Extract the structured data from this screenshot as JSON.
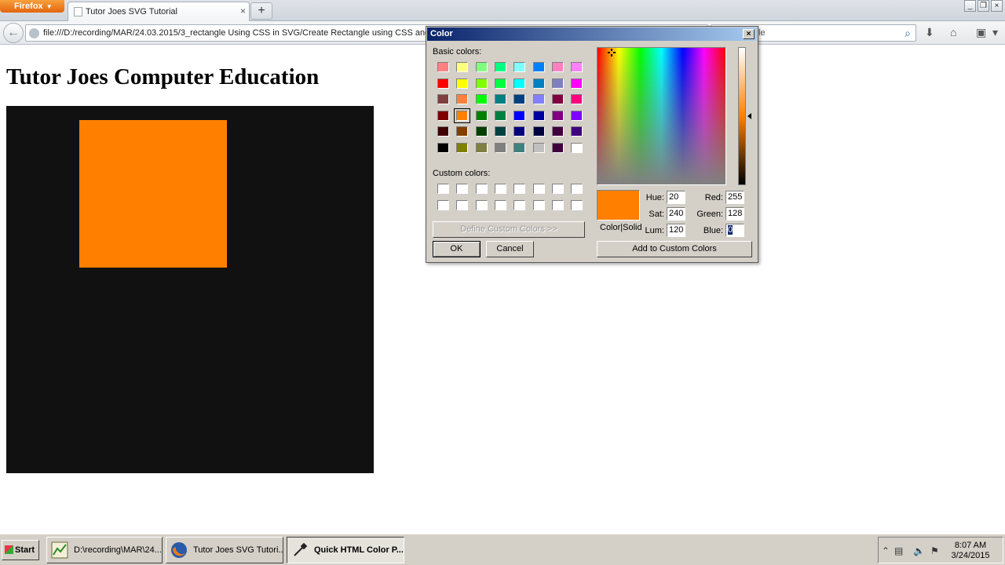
{
  "browser": {
    "menu_button": "Firefox",
    "tab_title": "Tutor Joes SVG Tutorial",
    "url": "file:///D:/recording/MAR/24.03.2015/3_rectangle Using CSS in SVG/Create Rectangle using CSS and SVG.html",
    "search_text": "le"
  },
  "page": {
    "heading": "Tutor Joes Computer Education",
    "svg_background": "#111111",
    "rect_fill": "#ff8000"
  },
  "color_dialog": {
    "title": "Color",
    "close_glyph": "×",
    "basic_colors_label": "Basic colors:",
    "custom_colors_label": "Custom colors:",
    "define_custom_button": "Define Custom Colors >>",
    "ok_button": "OK",
    "cancel_button": "Cancel",
    "add_custom_button": "Add to Custom Colors",
    "color_solid_label": "Color|Solid",
    "hue_label": "Hue:",
    "hue": "20",
    "sat_label": "Sat:",
    "sat": "240",
    "lum_label": "Lum:",
    "lum": "120",
    "red_label": "Red:",
    "red": "255",
    "green_label": "Green:",
    "green": "128",
    "blue_label": "Blue:",
    "blue": "0",
    "selected_color": "#ff8000",
    "basic_colors": [
      [
        "#ff8080",
        "#ffff80",
        "#80ff80",
        "#00ff80",
        "#80ffff",
        "#0080ff",
        "#ff80c0",
        "#ff80ff"
      ],
      [
        "#ff0000",
        "#ffff00",
        "#80ff00",
        "#00ff40",
        "#00ffff",
        "#0080c0",
        "#8080c0",
        "#ff00ff"
      ],
      [
        "#804040",
        "#ff8040",
        "#00ff00",
        "#008080",
        "#004080",
        "#8080ff",
        "#800040",
        "#ff0080"
      ],
      [
        "#800000",
        "#ff8000",
        "#008000",
        "#008040",
        "#0000ff",
        "#0000a0",
        "#800080",
        "#8000ff"
      ],
      [
        "#400000",
        "#804000",
        "#004000",
        "#004040",
        "#000080",
        "#000040",
        "#400040",
        "#400080"
      ],
      [
        "#000000",
        "#808000",
        "#808040",
        "#808080",
        "#408080",
        "#c0c0c0",
        "#400040",
        "#ffffff"
      ]
    ]
  },
  "taskbar": {
    "start": "Start",
    "tasks": [
      "D:\\recording\\MAR\\24...",
      "Tutor Joes SVG Tutori...",
      "Quick HTML Color P..."
    ],
    "time": "8:07 AM",
    "date": "3/24/2015"
  }
}
